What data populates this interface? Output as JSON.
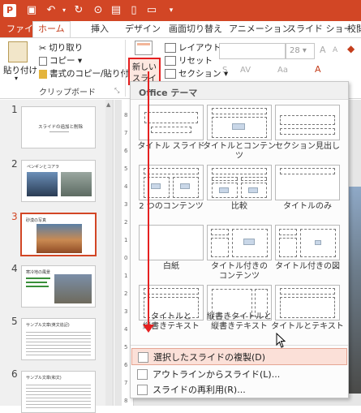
{
  "ribbon_tabs": [
    "ファイル",
    "ホーム",
    "挿入",
    "デザイン",
    "画面切り替え",
    "アニメーション",
    "スライド ショー",
    "校閲"
  ],
  "clipboard": {
    "paste": "貼り付け",
    "cut": "切り取り",
    "copy": "コピー",
    "format_painter": "書式のコピー/貼り付け",
    "group_label": "クリップボード"
  },
  "slides_group": {
    "new_slide_line1": "新しい",
    "new_slide_line2": "スライド",
    "layout": "レイアウト",
    "reset": "リセット",
    "section": "セクション"
  },
  "font_size_value": "28",
  "gallery": {
    "header": "Office テーマ",
    "layouts": [
      "タイトル スライド",
      "タイトルとコンテンツ",
      "セクション見出し",
      "2 つのコンテンツ",
      "比較",
      "タイトルのみ",
      "白紙",
      "タイトル付きの\nコンテンツ",
      "タイトル付きの図",
      "タイトルと\n縦書きテキスト",
      "縦書きタイトルと\n縦書きテキスト",
      "タイトルとテキスト"
    ],
    "menu": [
      "選択したスライドの複製(D)",
      "アウトラインからスライド(L)...",
      "スライドの再利用(R)..."
    ]
  },
  "thumbnails": [
    {
      "num": "1",
      "title": "スライドの追加と削除"
    },
    {
      "num": "2",
      "title": "ペンギンとコアラ"
    },
    {
      "num": "3",
      "title": "砂漠の写真"
    },
    {
      "num": "4",
      "title": "寒冷地の風景"
    },
    {
      "num": "5",
      "title": "サンプル文章(英文追記)"
    },
    {
      "num": "6",
      "title": "サンプル文章(和文)"
    }
  ],
  "ruler_marks": [
    "8",
    "7",
    "6",
    "5",
    "4",
    "3",
    "2",
    "1",
    "0",
    "1",
    "2",
    "3",
    "4",
    "5",
    "6",
    "7",
    "8"
  ],
  "colors": {
    "accent": "#d24625",
    "highlight": "#fbe0d8",
    "arrow": "#e52020"
  }
}
